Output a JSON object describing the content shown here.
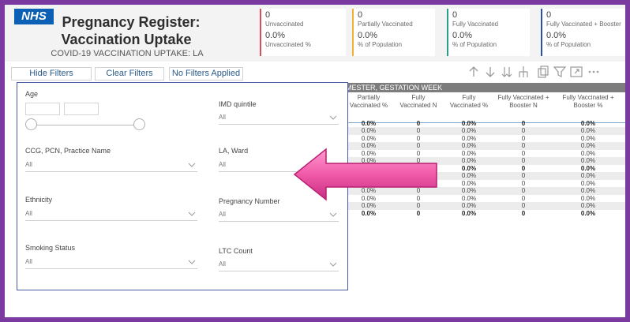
{
  "header": {
    "logo_text": "NHS",
    "title_line1": "Pregnancy Register:",
    "title_line2": "Vaccination Uptake",
    "subtitle": "COVID-19 VACCINATION UPTAKE: LA"
  },
  "cards": [
    {
      "count": "0",
      "label": "Unvaccinated",
      "pct": "0.0%",
      "pct_label": "Unvaccinated %",
      "color": "#d94f5c"
    },
    {
      "count": "0",
      "label": "Partially Vaccinated",
      "pct": "0.0%",
      "pct_label": "% of Population",
      "color": "#f2b134"
    },
    {
      "count": "0",
      "label": "Fully Vaccinated",
      "pct": "0.0%",
      "pct_label": "% of Population",
      "color": "#2a9d8f"
    },
    {
      "count": "0",
      "label": "Fully Vaccinated + Booster",
      "pct": "0.0%",
      "pct_label": "% of Population",
      "color": "#2b4fa8"
    }
  ],
  "toolbar": {
    "hide_filters": "Hide Filters",
    "clear_filters": "Clear Filters",
    "no_filters": "No Filters Applied",
    "icons": [
      "arrow-up-icon",
      "arrow-down-icon",
      "double-arrow-down-icon",
      "expand-hierarchy-icon",
      "copy-icon",
      "filter-icon",
      "focus-mode-icon",
      "more-options-icon"
    ]
  },
  "table": {
    "group_header": "MESTER, GESTATION WEEK",
    "columns": [
      [
        "Partially",
        "Vaccinated %"
      ],
      [
        "Fully",
        "Vaccinated N"
      ],
      [
        "Fully",
        "Vaccinated %"
      ],
      [
        "Fully Vaccinated +",
        "Booster N"
      ],
      [
        "Fully Vaccinated +",
        "Booster %"
      ]
    ],
    "rows": [
      {
        "bold": true,
        "cells": [
          "0.0%",
          "0",
          "0.0%",
          "0",
          "0.0%"
        ]
      },
      {
        "bold": false,
        "cells": [
          "0.0%",
          "0",
          "0.0%",
          "0",
          "0.0%"
        ]
      },
      {
        "bold": false,
        "cells": [
          "0.0%",
          "0",
          "0.0%",
          "0",
          "0.0%"
        ]
      },
      {
        "bold": false,
        "cells": [
          "0.0%",
          "0",
          "0.0%",
          "0",
          "0.0%"
        ]
      },
      {
        "bold": false,
        "cells": [
          "0.0%",
          "0",
          "0.0%",
          "0",
          "0.0%"
        ]
      },
      {
        "bold": false,
        "cells": [
          "0.0%",
          "0",
          "0.0%",
          "0",
          "0.0%"
        ]
      },
      {
        "bold": true,
        "cells": [
          "0.0%",
          "0",
          "0.0%",
          "0",
          "0.0%"
        ]
      },
      {
        "bold": false,
        "cells": [
          "0.0%",
          "0",
          "0.0%",
          "0",
          "0.0%"
        ]
      },
      {
        "bold": false,
        "cells": [
          "0.0%",
          "0",
          "0.0%",
          "0",
          "0.0%"
        ]
      },
      {
        "bold": false,
        "cells": [
          "0.0%",
          "0",
          "0.0%",
          "0",
          "0.0%"
        ]
      },
      {
        "bold": false,
        "cells": [
          "0.0%",
          "0",
          "0.0%",
          "0",
          "0.0%"
        ]
      },
      {
        "bold": false,
        "cells": [
          "0.0%",
          "0",
          "0.0%",
          "0",
          "0.0%"
        ]
      },
      {
        "bold": true,
        "cells": [
          "0.0%",
          "0",
          "0.0%",
          "0",
          "0.0%"
        ]
      }
    ]
  },
  "filters": {
    "age_label": "Age",
    "imd_label": "IMD quintile",
    "imd_value": "All",
    "ccg_label": "CCG, PCN, Practice Name",
    "ccg_value": "All",
    "la_label": "LA, Ward",
    "la_value": "All",
    "ethnicity_label": "Ethnicity",
    "ethnicity_value": "All",
    "pregnancy_label": "Pregnancy Number",
    "pregnancy_value": "All",
    "smoking_label": "Smoking Status",
    "smoking_value": "All",
    "ltc_label": "LTC Count",
    "ltc_value": "All"
  },
  "colors": {
    "frame": "#7a3aa0",
    "nhs_blue": "#0b5fb4",
    "pane_border": "#4a5aa8",
    "arrow_pink": "#e8469a"
  }
}
